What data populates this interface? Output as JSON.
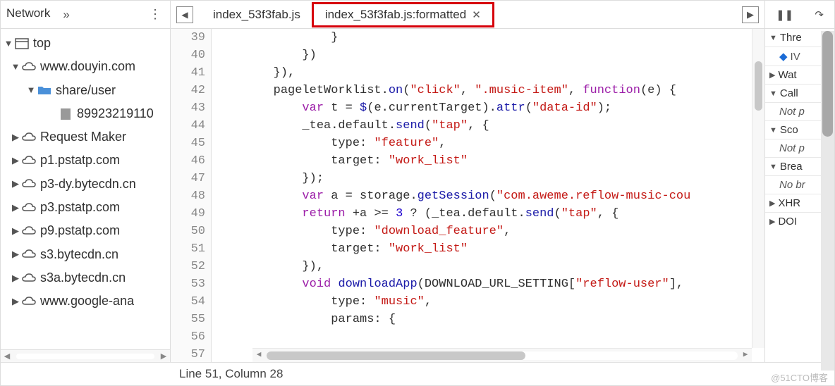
{
  "left": {
    "tab_name": "Network",
    "overflow_glyph": "»",
    "menu_glyph": "⋮",
    "tree": [
      {
        "level": 0,
        "tri": "▼",
        "icon": "window",
        "label": "top"
      },
      {
        "level": 1,
        "tri": "▼",
        "icon": "cloud",
        "label": "www.douyin.com"
      },
      {
        "level": 2,
        "tri": "▼",
        "icon": "folder",
        "label": "share/user"
      },
      {
        "level": 3,
        "tri": "",
        "icon": "file",
        "label": "89923219110"
      },
      {
        "level": 1,
        "tri": "▶",
        "icon": "cloud",
        "label": "Request Maker"
      },
      {
        "level": 1,
        "tri": "▶",
        "icon": "cloud",
        "label": "p1.pstatp.com"
      },
      {
        "level": 1,
        "tri": "▶",
        "icon": "cloud",
        "label": "p3-dy.bytecdn.cn"
      },
      {
        "level": 1,
        "tri": "▶",
        "icon": "cloud",
        "label": "p3.pstatp.com"
      },
      {
        "level": 1,
        "tri": "▶",
        "icon": "cloud",
        "label": "p9.pstatp.com"
      },
      {
        "level": 1,
        "tri": "▶",
        "icon": "cloud",
        "label": "s3.bytecdn.cn"
      },
      {
        "level": 1,
        "tri": "▶",
        "icon": "cloud",
        "label": "s3a.bytecdn.cn"
      },
      {
        "level": 1,
        "tri": "▶",
        "icon": "cloud",
        "label": "www.google-ana"
      }
    ]
  },
  "editor": {
    "tab1": "index_53f3fab.js",
    "tab2": "index_53f3fab.js:formatted",
    "gutter": [
      "39",
      "40",
      "41",
      "42",
      "43",
      "44",
      "45",
      "46",
      "47",
      "48",
      "49",
      "50",
      "51",
      "52",
      "53",
      "54",
      "55",
      "56",
      "57"
    ]
  },
  "right": {
    "pause_glyph": "❚❚",
    "step_glyph": "↷",
    "sections": {
      "threads": "Thre",
      "iv_entry": "IV",
      "watch": "Wat",
      "call": "Call",
      "notp1": "Not p",
      "scope": "Sco",
      "notp2": "Not p",
      "break": "Brea",
      "nobr": "No br",
      "xhr": "XHR",
      "dom": "DOI"
    }
  },
  "status": "Line 51, Column 28",
  "watermark": "@51CTO博客"
}
